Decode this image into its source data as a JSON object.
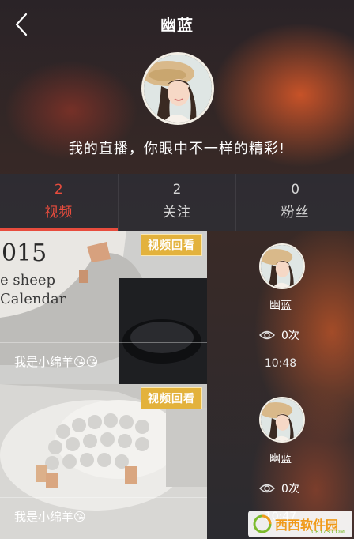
{
  "header": {
    "title": "幽蓝",
    "slogan": "我的直播，你眼中不一样的精彩!"
  },
  "tabs": [
    {
      "count": "2",
      "label": "视频",
      "active": true
    },
    {
      "count": "2",
      "label": "关注",
      "active": false
    },
    {
      "count": "0",
      "label": "粉丝",
      "active": false
    }
  ],
  "videos": [
    {
      "badge": "视频回看",
      "caption": "我是小绵羊😘😘",
      "thumb_text_1": "015",
      "thumb_text_2": "e sheep",
      "thumb_text_3": "Calendar",
      "user": "幽蓝",
      "views": "0次",
      "time": "10:48"
    },
    {
      "badge": "视频回看",
      "caption": "我是小绵羊😘",
      "user": "幽蓝",
      "views": "0次",
      "time": "10:47"
    }
  ],
  "watermark": {
    "main": "西西软件园",
    "sub": "CR173.COM"
  },
  "colors": {
    "accent": "#e84c3d",
    "badge": "#e3b23c"
  }
}
